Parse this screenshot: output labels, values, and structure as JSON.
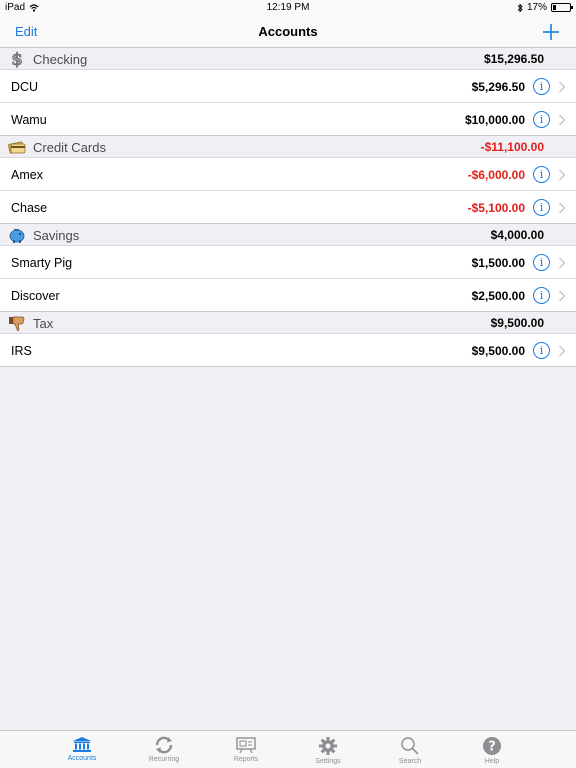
{
  "status_bar": {
    "device": "iPad",
    "time": "12:19 PM",
    "battery": "17%",
    "battery_level": 0.17
  },
  "nav": {
    "edit_label": "Edit",
    "title": "Accounts",
    "add_icon": "plus-icon"
  },
  "sections": [
    {
      "name": "Checking",
      "icon": "dollar-sign-icon",
      "total": "$15,296.50",
      "accounts": [
        {
          "name": "DCU",
          "amount": "$5,296.50"
        },
        {
          "name": "Wamu",
          "amount": "$10,000.00"
        }
      ]
    },
    {
      "name": "Credit Cards",
      "icon": "credit-cards-icon",
      "total": "-$11,100.00",
      "accounts": [
        {
          "name": "Amex",
          "amount": "-$6,000.00"
        },
        {
          "name": "Chase",
          "amount": "-$5,100.00"
        }
      ]
    },
    {
      "name": "Savings",
      "icon": "piggy-bank-icon",
      "total": "$4,000.00",
      "accounts": [
        {
          "name": "Smarty Pig",
          "amount": "$1,500.00"
        },
        {
          "name": "Discover",
          "amount": "$2,500.00"
        }
      ]
    },
    {
      "name": "Tax",
      "icon": "thumbs-down-icon",
      "total": "$9,500.00",
      "accounts": [
        {
          "name": "IRS",
          "amount": "$9,500.00"
        }
      ]
    }
  ],
  "tabs": [
    {
      "label": "Accounts",
      "icon": "bank-icon",
      "active": true
    },
    {
      "label": "Recurring",
      "icon": "recurring-arrows-icon",
      "active": false
    },
    {
      "label": "Reports",
      "icon": "reports-board-icon",
      "active": false
    },
    {
      "label": "Settings",
      "icon": "gear-icon",
      "active": false
    },
    {
      "label": "Search",
      "icon": "search-icon",
      "active": false
    },
    {
      "label": "Help",
      "icon": "help-icon",
      "active": false
    }
  ],
  "colors": {
    "accent": "#1a7ce0",
    "negative": "#e0201b",
    "inactive_tab": "#8e8e93"
  }
}
